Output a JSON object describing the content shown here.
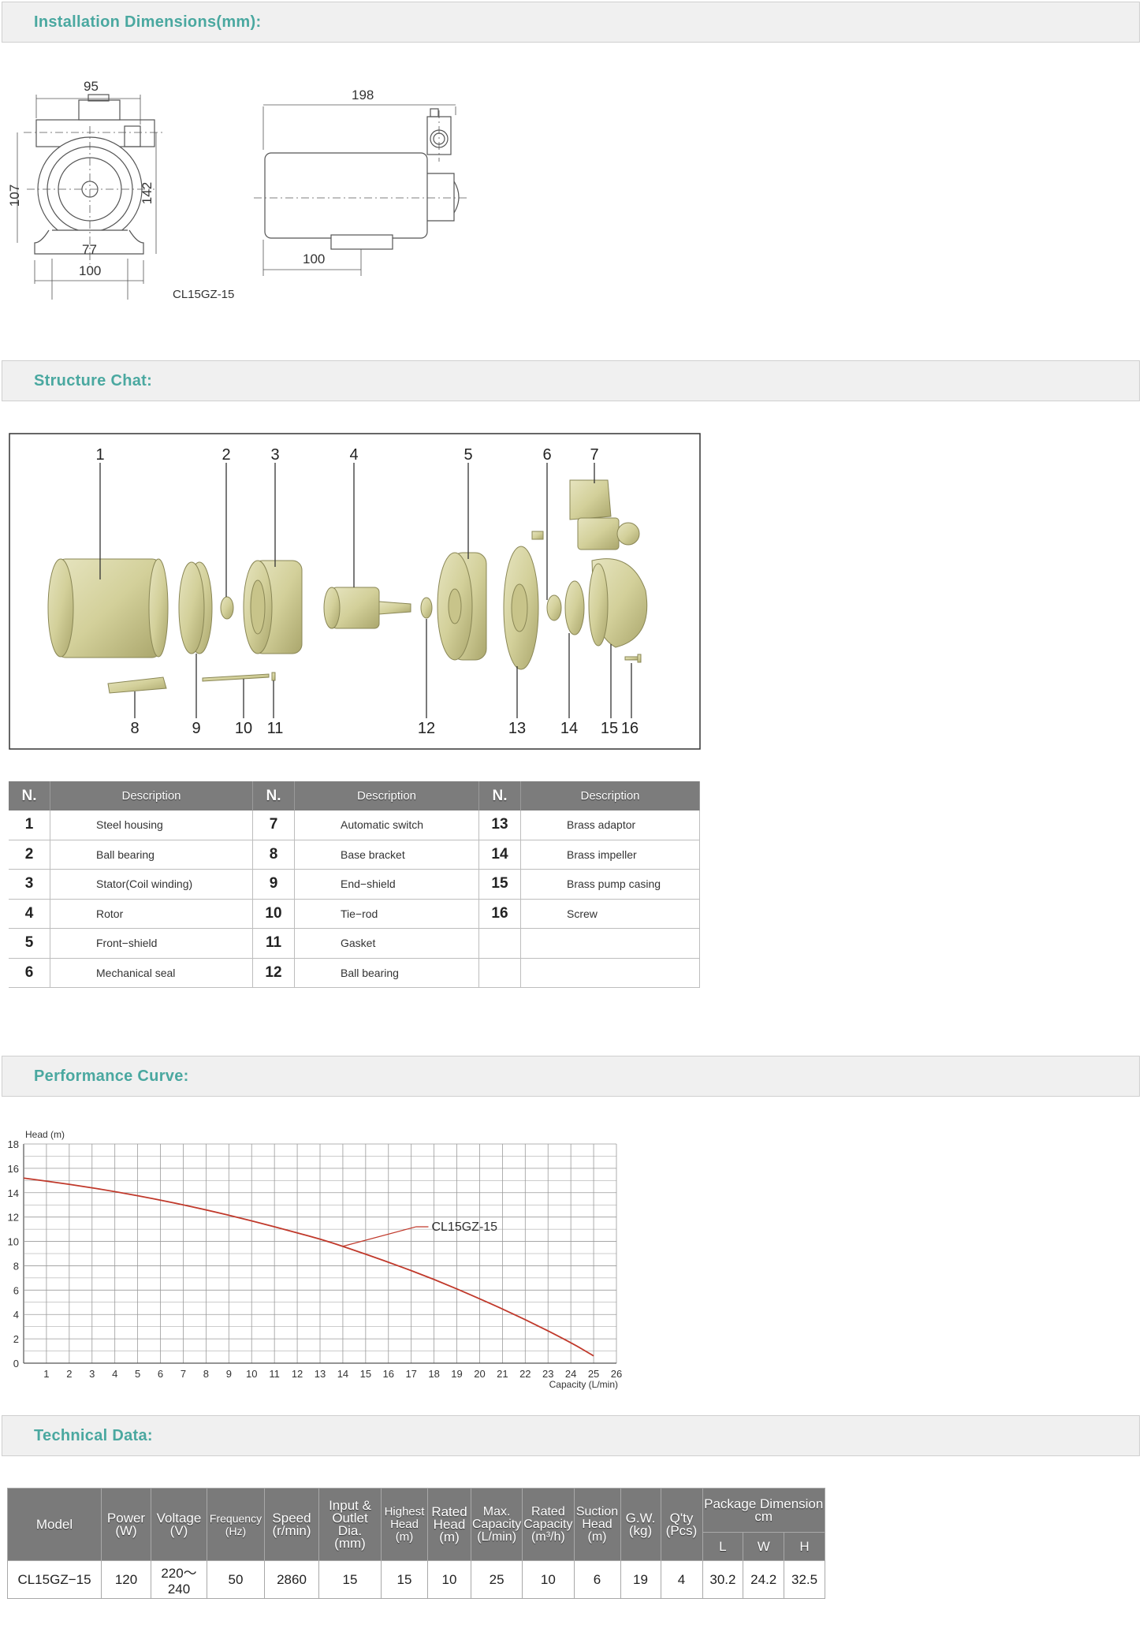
{
  "sections": {
    "installation": "Installation Dimensions(mm):",
    "structure": "Structure Chat:",
    "performance": "Performance Curve:",
    "technical": "Technical Data:"
  },
  "installation": {
    "front_dims": [
      "95",
      "107",
      "142",
      "77",
      "100"
    ],
    "side_dims": [
      "198",
      "100"
    ],
    "model_label": "CL15GZ-15"
  },
  "structure": {
    "callouts_top": [
      "1",
      "2",
      "3",
      "4",
      "5",
      "6",
      "7"
    ],
    "callouts_bottom": [
      "8",
      "9",
      "10",
      "11",
      "12",
      "13",
      "14",
      "15",
      "16"
    ],
    "table_headers": {
      "n": "N.",
      "description": "Description"
    },
    "parts": [
      {
        "n": "1",
        "desc": "Steel housing"
      },
      {
        "n": "2",
        "desc": "Ball bearing"
      },
      {
        "n": "3",
        "desc": "Stator(Coil winding)"
      },
      {
        "n": "4",
        "desc": "Rotor"
      },
      {
        "n": "5",
        "desc": "Front−shield"
      },
      {
        "n": "6",
        "desc": "Mechanical seal"
      },
      {
        "n": "7",
        "desc": "Automatic switch"
      },
      {
        "n": "8",
        "desc": "Base bracket"
      },
      {
        "n": "9",
        "desc": "End−shield"
      },
      {
        "n": "10",
        "desc": "Tie−rod"
      },
      {
        "n": "11",
        "desc": "Gasket"
      },
      {
        "n": "12",
        "desc": "Ball bearing"
      },
      {
        "n": "13",
        "desc": "Brass adaptor"
      },
      {
        "n": "14",
        "desc": "Brass impeller"
      },
      {
        "n": "15",
        "desc": "Brass pump casing"
      },
      {
        "n": "16",
        "desc": "Screw"
      }
    ]
  },
  "chart_data": {
    "type": "line",
    "title": "",
    "ylabel": "Head (m)",
    "xlabel": "Capacity (L/min)",
    "xlim": [
      0,
      26
    ],
    "ylim": [
      0,
      18
    ],
    "x_ticks": [
      1,
      2,
      3,
      4,
      5,
      6,
      7,
      8,
      9,
      10,
      11,
      12,
      13,
      14,
      15,
      16,
      17,
      18,
      19,
      20,
      21,
      22,
      23,
      24,
      25,
      26
    ],
    "y_ticks": [
      0,
      2,
      4,
      6,
      8,
      10,
      12,
      14,
      16,
      18
    ],
    "grid": true,
    "curve_color": "#c0392b",
    "series": [
      {
        "name": "CL15GZ-15",
        "x": [
          0,
          2,
          4,
          6,
          8,
          10,
          12,
          13,
          14,
          16,
          18,
          20,
          22,
          24,
          25
        ],
        "y": [
          15.2,
          14.7,
          14.1,
          13.4,
          12.6,
          11.7,
          10.7,
          10.2,
          9.6,
          8.3,
          6.9,
          5.3,
          3.6,
          1.7,
          0.6
        ]
      }
    ],
    "annotation": {
      "text": "CL15GZ-15"
    }
  },
  "technical": {
    "headers": {
      "model": "Model",
      "power": [
        "Power",
        "(W)"
      ],
      "voltage": [
        "Voltage",
        "(V)"
      ],
      "frequency": [
        "Frequency",
        "(Hz)"
      ],
      "speed": [
        "Speed",
        "(r/min)"
      ],
      "io": [
        "Input &",
        "Outlet Dia.",
        "(mm)"
      ],
      "highest_head": [
        "Highest",
        "Head",
        "(m)"
      ],
      "rated_head": [
        "Rated",
        "Head",
        "(m)"
      ],
      "max_capacity": [
        "Max.",
        "Capacity",
        "(L/min)"
      ],
      "rated_capacity": [
        "Rated",
        "Capacity",
        "(m³/h)"
      ],
      "suction": [
        "Suction",
        "Head",
        "(m)"
      ],
      "gw": [
        "G.W.",
        "(kg)"
      ],
      "qty": [
        "Q'ty",
        "(Pcs)"
      ],
      "package": [
        "Package Dimension",
        "cm"
      ],
      "l": "L",
      "w": "W",
      "h": "H"
    },
    "row": {
      "model": "CL15GZ−15",
      "power": "120",
      "voltage": "220～240",
      "frequency": "50",
      "speed": "2860",
      "io": "15",
      "highest_head": "15",
      "rated_head": "10",
      "max_capacity": "25",
      "rated_capacity": "10",
      "suction": "6",
      "gw": "19",
      "qty": "4",
      "l": "30.2",
      "w": "24.2",
      "h": "32.5"
    }
  }
}
